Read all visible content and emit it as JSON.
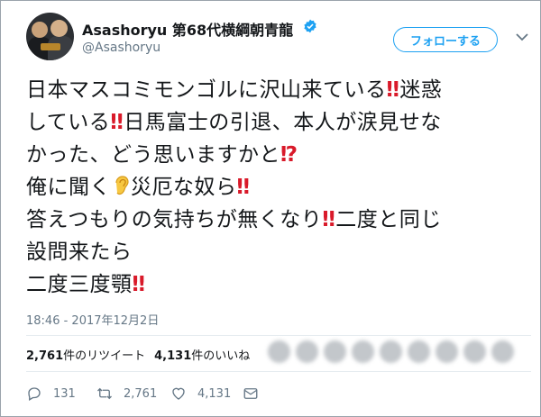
{
  "user": {
    "display_name": "Asashoryu 第68代横綱朝青龍",
    "handle": "@Asashoryu",
    "verified_icon": "verified-badge-icon"
  },
  "follow_button": {
    "label": "フォローする"
  },
  "tweet": {
    "lines": [
      {
        "segments": [
          "日本マスコミモンゴルに沢山来ている",
          "‼",
          "迷惑"
        ]
      },
      {
        "segments": [
          "している",
          "‼",
          "日馬富士の引退、本人が涙見せな"
        ]
      },
      {
        "segments": [
          "かった、どう思いますかと",
          "⁉"
        ]
      },
      {
        "segments": [
          "俺に聞く",
          "ear-emoji",
          "災厄な奴ら",
          "‼"
        ]
      },
      {
        "segments": [
          "答えつもりの気持ちが無くなり",
          "‼",
          "二度と同じ"
        ]
      },
      {
        "segments": [
          "設問来たら"
        ]
      },
      {
        "segments": [
          "二度三度顎",
          "‼"
        ]
      }
    ],
    "timestamp": "18:46 - 2017年12月2日"
  },
  "stats": {
    "retweets_count": "2,761",
    "retweets_label": "件のリツイート",
    "likes_count": "4,131",
    "likes_label": "件のいいね"
  },
  "actions": {
    "reply_count": "131",
    "retweet_count": "2,761",
    "like_count": "4,131"
  },
  "colors": {
    "accent": "#1da1f2",
    "emphasis": "#d91a2a",
    "secondary_text": "#657786"
  }
}
